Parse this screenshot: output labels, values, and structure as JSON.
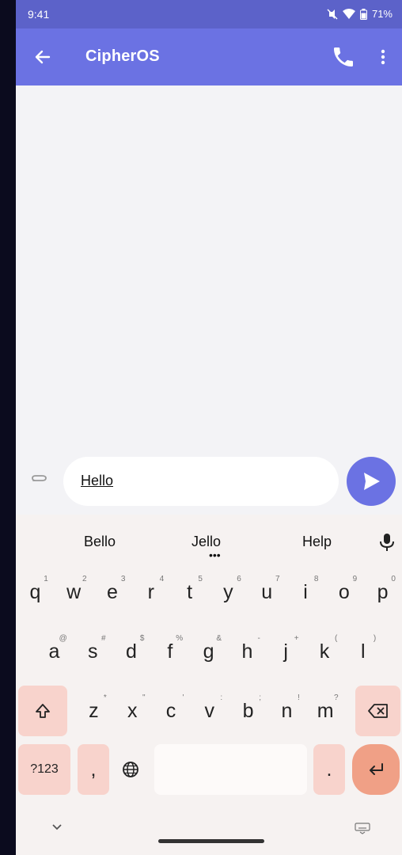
{
  "status_bar": {
    "time": "9:41",
    "battery": "71%"
  },
  "app_bar": {
    "title": "CipherOS",
    "back_icon": "arrow-left-icon",
    "call_icon": "phone-icon",
    "menu_icon": "more-vert-icon"
  },
  "composer": {
    "text": "Hello",
    "attach_icon": "paperclip-icon",
    "send_icon": "send-icon"
  },
  "keyboard": {
    "suggestions": [
      "Bello",
      "Jello",
      "Help"
    ],
    "row1": [
      {
        "key": "q",
        "hint": "1"
      },
      {
        "key": "w",
        "hint": "2"
      },
      {
        "key": "e",
        "hint": "3"
      },
      {
        "key": "r",
        "hint": "4"
      },
      {
        "key": "t",
        "hint": "5"
      },
      {
        "key": "y",
        "hint": "6"
      },
      {
        "key": "u",
        "hint": "7"
      },
      {
        "key": "i",
        "hint": "8"
      },
      {
        "key": "o",
        "hint": "9"
      },
      {
        "key": "p",
        "hint": "0"
      }
    ],
    "row2": [
      {
        "key": "a",
        "hint": "@"
      },
      {
        "key": "s",
        "hint": "#"
      },
      {
        "key": "d",
        "hint": "$"
      },
      {
        "key": "f",
        "hint": "%"
      },
      {
        "key": "g",
        "hint": "&"
      },
      {
        "key": "h",
        "hint": "-"
      },
      {
        "key": "j",
        "hint": "+"
      },
      {
        "key": "k",
        "hint": "("
      },
      {
        "key": "l",
        "hint": ")"
      }
    ],
    "row3": [
      {
        "key": "z",
        "hint": "*"
      },
      {
        "key": "x",
        "hint": "\""
      },
      {
        "key": "c",
        "hint": "'"
      },
      {
        "key": "v",
        "hint": ":"
      },
      {
        "key": "b",
        "hint": ";"
      },
      {
        "key": "n",
        "hint": "!"
      },
      {
        "key": "m",
        "hint": "?"
      }
    ],
    "symbols_label": "?123",
    "comma_label": ",",
    "period_label": "."
  },
  "colors": {
    "app_bar": "#6b72e3",
    "status_bar": "#5c62c9",
    "fn_key": "#f8d3cc",
    "enter_key": "#f0a086"
  }
}
